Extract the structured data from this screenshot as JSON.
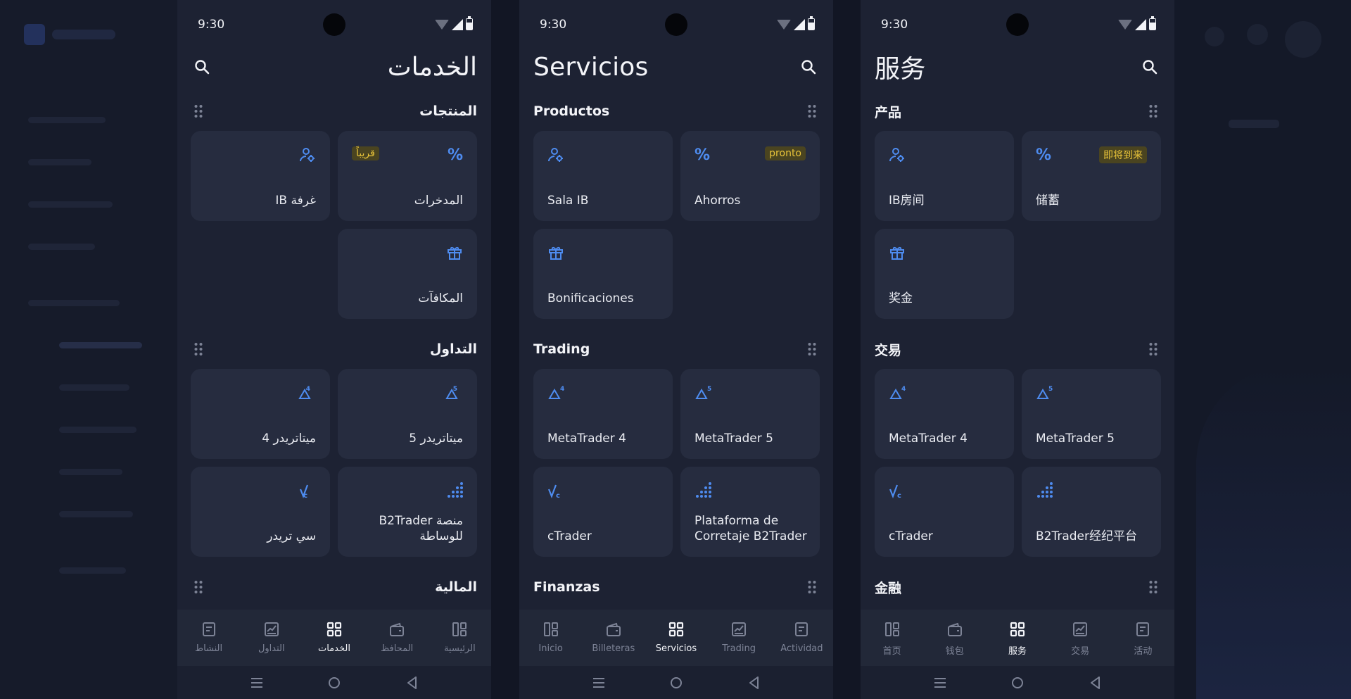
{
  "colors": {
    "accent": "#4e8cf0",
    "badge_bg": "#4a4420",
    "badge_text": "#e9c43a",
    "tile_bg": "#262c3f",
    "panel_bg": "#1d2233"
  },
  "phones": {
    "ar": {
      "time": "9:30",
      "title": "الخدمات",
      "sections": [
        {
          "title": "المنتجات",
          "tiles": [
            {
              "label": "المدخرات",
              "icon": "percent-icon",
              "badge": "قريباً"
            },
            {
              "label": "غرفة IB",
              "icon": "ib-room-icon"
            },
            {
              "label": "المكافآت",
              "icon": "gift-icon"
            }
          ]
        },
        {
          "title": "التداول",
          "tiles": [
            {
              "label": "ميتاتريدر 5",
              "icon": "metatrader-5-icon"
            },
            {
              "label": "ميتاتريدر 4",
              "icon": "metatrader-4-icon"
            },
            {
              "label": "منصة B2Trader للوساطة",
              "icon": "b2trader-icon"
            },
            {
              "label": "سي تريدر",
              "icon": "ctrader-icon"
            }
          ]
        },
        {
          "title": "المالية",
          "tiles": []
        }
      ],
      "nav": [
        "النشاط",
        "التداول",
        "الخدمات",
        "المحافظ",
        "الرئيسية"
      ]
    },
    "es": {
      "time": "9:30",
      "title": "Servicios",
      "sections": [
        {
          "title": "Productos",
          "tiles": [
            {
              "label": "Sala IB",
              "icon": "ib-room-icon"
            },
            {
              "label": "Ahorros",
              "icon": "percent-icon",
              "badge": "pronto"
            },
            {
              "label": "Bonificaciones",
              "icon": "gift-icon"
            }
          ]
        },
        {
          "title": "Trading",
          "tiles": [
            {
              "label": "MetaTrader 4",
              "icon": "metatrader-4-icon"
            },
            {
              "label": "MetaTrader 5",
              "icon": "metatrader-5-icon"
            },
            {
              "label": "cTrader",
              "icon": "ctrader-icon"
            },
            {
              "label": "Plataforma de Corretaje B2Trader",
              "icon": "b2trader-icon"
            }
          ]
        },
        {
          "title": "Finanzas",
          "tiles": []
        }
      ],
      "nav": [
        "Inicio",
        "Billeteras",
        "Servicios",
        "Trading",
        "Actividad"
      ]
    },
    "zh": {
      "time": "9:30",
      "title": "服务",
      "sections": [
        {
          "title": "产品",
          "tiles": [
            {
              "label": "IB房间",
              "icon": "ib-room-icon"
            },
            {
              "label": "储蓄",
              "icon": "percent-icon",
              "badge": "即将到来"
            },
            {
              "label": "奖金",
              "icon": "gift-icon"
            }
          ]
        },
        {
          "title": "交易",
          "tiles": [
            {
              "label": "MetaTrader 4",
              "icon": "metatrader-4-icon"
            },
            {
              "label": "MetaTrader 5",
              "icon": "metatrader-5-icon"
            },
            {
              "label": "cTrader",
              "icon": "ctrader-icon"
            },
            {
              "label": "B2Trader经纪平台",
              "icon": "b2trader-icon"
            }
          ]
        },
        {
          "title": "金融",
          "tiles": []
        }
      ],
      "nav": [
        "首页",
        "钱包",
        "服务",
        "交易",
        "活动"
      ]
    }
  }
}
